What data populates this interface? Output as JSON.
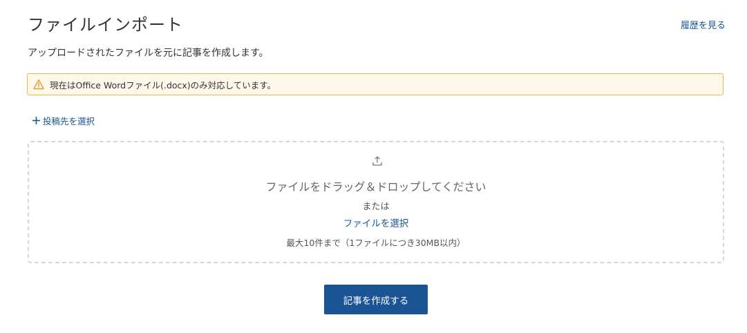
{
  "header": {
    "title": "ファイルインポート",
    "history_link": "履歴を見る"
  },
  "subtitle": "アップロードされたファイルを元に記事を作成します。",
  "notice": {
    "icon": "warning-icon",
    "text": "現在はOffice Wordファイル(.docx)のみ対応しています。"
  },
  "select_destination": {
    "icon": "plus-icon",
    "label": "投稿先を選択"
  },
  "dropzone": {
    "icon": "upload-icon",
    "message": "ファイルをドラッグ＆ドロップしてください",
    "or": "または",
    "choose_file": "ファイルを選択",
    "limit": "最大10件まで（1ファイルにつき30MB以内）"
  },
  "create_button": "記事を作成する",
  "colors": {
    "accent": "#1a5494",
    "warning_border": "#e8b84a",
    "warning_bg": "#fdf8ea"
  }
}
